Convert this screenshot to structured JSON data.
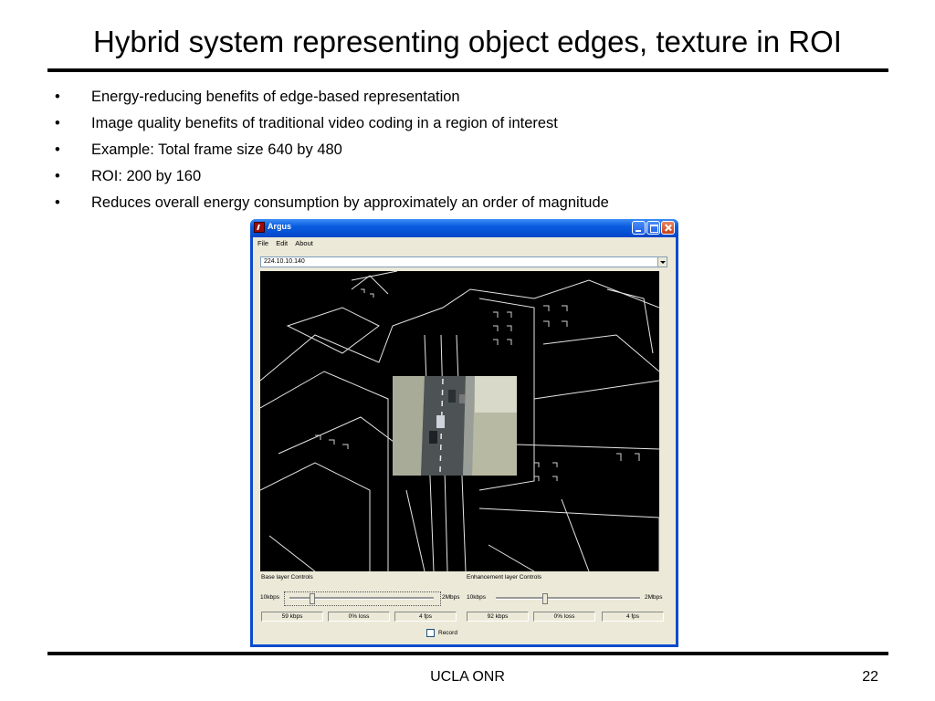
{
  "slide": {
    "title": "Hybrid system representing object edges, texture in ROI",
    "bullet_glyph": "•",
    "bullets": [
      "Energy-reducing benefits of edge-based representation",
      "Image quality benefits of traditional video coding in a region of interest",
      "Example: Total frame size 640 by 480",
      "ROI: 200 by 160",
      "Reduces overall energy consumption by approximately an order of magnitude"
    ],
    "footer": "UCLA ONR",
    "page_number": "22"
  },
  "window": {
    "title": "Argus",
    "menu": [
      "File",
      "Edit",
      "About"
    ],
    "address_value": "224.10.10.140",
    "base_layer": {
      "label": "Base layer Controls",
      "min_label": "10kbps",
      "max_label": "2Mbps",
      "slider_fraction": 0.14,
      "stats": [
        "59 kbps",
        "0% loss",
        "4 fps"
      ]
    },
    "enhancement_layer": {
      "label": "Enhancement  layer Controls",
      "min_label": "10kbps",
      "max_label": "2Mbps",
      "slider_fraction": 0.32,
      "stats": [
        "92 kbps",
        "0% loss",
        "4 fps"
      ]
    },
    "record_label": "Record",
    "record_checked": false
  },
  "colors": {
    "titlebar": "#0a5ce0",
    "window_face": "#ece9d8",
    "video_background": "#000000",
    "close_button": "#c8401b"
  }
}
